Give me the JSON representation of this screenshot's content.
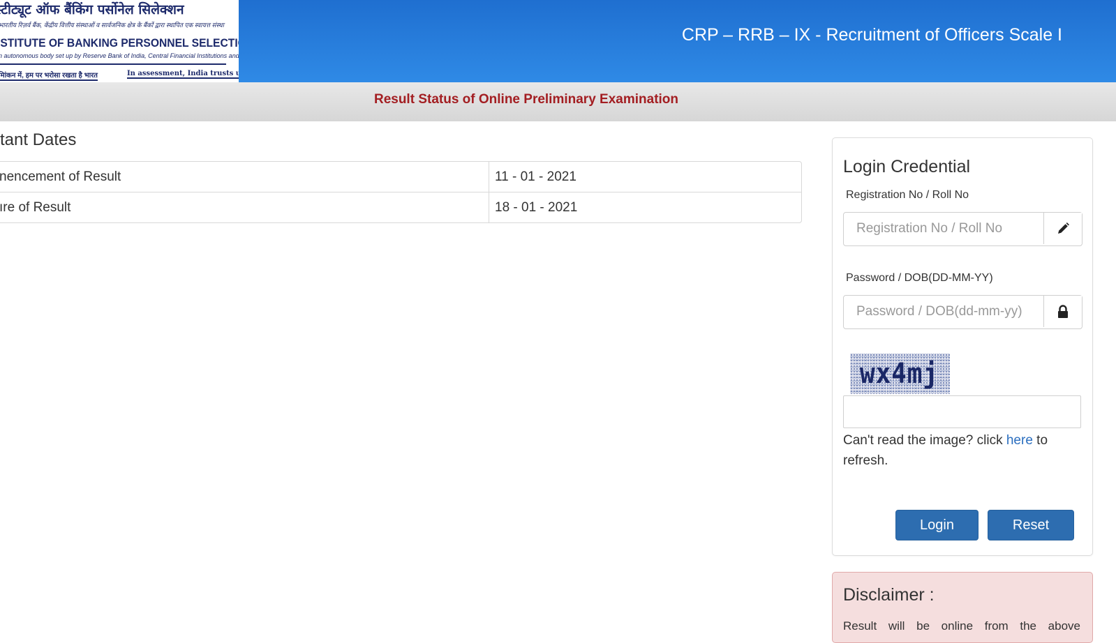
{
  "header": {
    "logo": {
      "hindi_title": "स्टीट्यूट ऑफ बैंकिंग पर्सोनेल सिलेक्शन",
      "hindi_subtitle": "भारतीय रिज़र्व बैंक, केंद्रीय वित्तीय संस्थाओं व सार्वजनिक क्षेत्र के बैंकों द्वारा स्थापित एक स्वायत्त संस्था",
      "english_title": "ISTITUTE OF BANKING PERSONNEL SELECTION",
      "english_subtitle": "n autonomous body set up by Reserve Bank of India, Central Financial Institutions and Public Sector Banks",
      "tagline_hindi": "मिांकन में, हम पर भरोसा रखता है भारत",
      "tagline_english": "In assessment, India trusts us"
    },
    "title": "CRP – RRB – IX - Recruitment of Officers Scale I"
  },
  "subbar": {
    "title": "Result Status of Online Preliminary Examination"
  },
  "dates": {
    "title": "rtant Dates",
    "rows": [
      {
        "label": "nencement of Result",
        "value": "11 - 01 - 2021"
      },
      {
        "label": "ıre of Result",
        "value": "18 - 01 - 2021"
      }
    ]
  },
  "login": {
    "title": "Login Credential",
    "registration_label": "Registration No / Roll No",
    "registration_placeholder": "Registration No / Roll No",
    "password_label": "Password / DOB(DD-MM-YY)",
    "password_placeholder": "Password / DOB(dd-mm-yy)",
    "captcha_text": "wx4mj",
    "captcha_input_value": "",
    "refresh_prefix": "Can't read the image? click ",
    "refresh_link": "here",
    "refresh_suffix": " to refresh.",
    "login_button": "Login",
    "reset_button": "Reset"
  },
  "disclaimer": {
    "title": "Disclaimer :",
    "text": "Result will be online from the above"
  },
  "icons": {
    "registration_addon": "pencil-icon",
    "password_addon": "lock-icon"
  },
  "colors": {
    "header_blue": "#2f8ae6",
    "subbar_title_red": "#a31e22",
    "button_blue": "#2d6db0",
    "link_blue": "#2a6ebf",
    "disclaimer_bg": "#f5dede"
  }
}
